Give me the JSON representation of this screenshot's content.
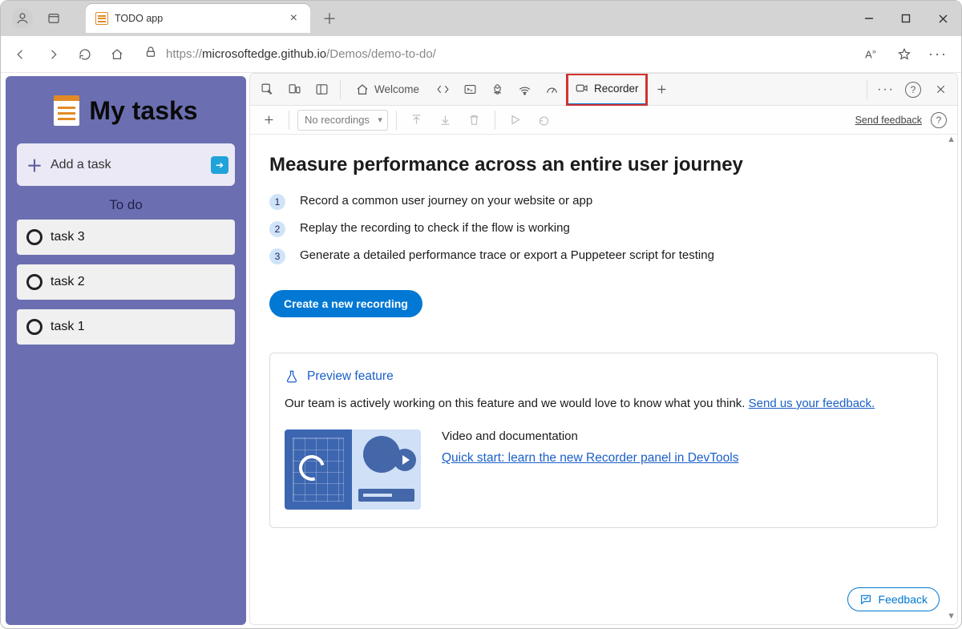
{
  "browser": {
    "tab_title": "TODO app",
    "url_secure": "https://",
    "url_host": "microsoftedge.github.io",
    "url_path": "/Demos/demo-to-do/"
  },
  "todo": {
    "title": "My tasks",
    "add_label": "Add a task",
    "section": "To do",
    "tasks": [
      "task 3",
      "task 2",
      "task 1"
    ]
  },
  "devtools": {
    "tabs": {
      "welcome": "Welcome",
      "recorder": "Recorder"
    },
    "toolbar": {
      "no_recordings": "No recordings",
      "send_feedback": "Send feedback"
    },
    "heading": "Measure performance across an entire user journey",
    "steps": [
      "Record a common user journey on your website or app",
      "Replay the recording to check if the flow is working",
      "Generate a detailed performance trace or export a Puppeteer script for testing"
    ],
    "create_button": "Create a new recording",
    "preview": {
      "badge": "Preview feature",
      "text_before": "Our team is actively working on this feature and we would love to know what you think. ",
      "link": "Send us your feedback.",
      "video_label": "Video and documentation",
      "video_link": "Quick start: learn the new Recorder panel in DevTools"
    },
    "feedback_button": "Feedback"
  }
}
